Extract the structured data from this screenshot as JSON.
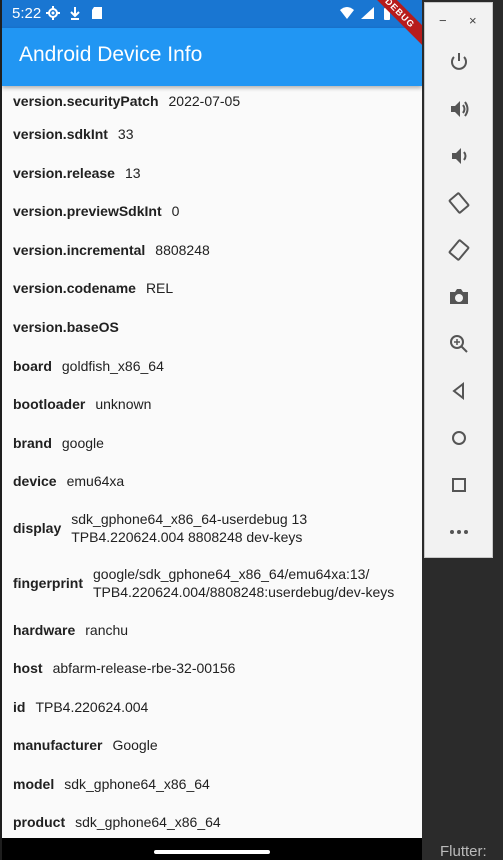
{
  "status_bar": {
    "time": "5:22"
  },
  "app_bar": {
    "title": "Android Device Info",
    "debug_banner": "DEBUG"
  },
  "rows": [
    {
      "key": "version.securityPatch",
      "value": "2022-07-05"
    },
    {
      "key": "version.sdkInt",
      "value": "33"
    },
    {
      "key": "version.release",
      "value": "13"
    },
    {
      "key": "version.previewSdkInt",
      "value": "0"
    },
    {
      "key": "version.incremental",
      "value": "8808248"
    },
    {
      "key": "version.codename",
      "value": "REL"
    },
    {
      "key": "version.baseOS",
      "value": ""
    },
    {
      "key": "board",
      "value": "goldfish_x86_64"
    },
    {
      "key": "bootloader",
      "value": "unknown"
    },
    {
      "key": "brand",
      "value": "google"
    },
    {
      "key": "device",
      "value": "emu64xa"
    },
    {
      "key": "display",
      "value": "sdk_gphone64_x86_64-userdebug 13 TPB4.220624.004 8808248 dev-keys"
    },
    {
      "key": "fingerprint",
      "value": "google/sdk_gphone64_x86_64/emu64xa:13/ TPB4.220624.004/8808248:userdebug/dev-keys"
    },
    {
      "key": "hardware",
      "value": "ranchu"
    },
    {
      "key": "host",
      "value": "abfarm-release-rbe-32-00156"
    },
    {
      "key": "id",
      "value": "TPB4.220624.004"
    },
    {
      "key": "manufacturer",
      "value": "Google"
    },
    {
      "key": "model",
      "value": "sdk_gphone64_x86_64"
    },
    {
      "key": "product",
      "value": "sdk_gphone64_x86_64"
    }
  ],
  "emulator_panel": {
    "minimize": "−",
    "close": "×",
    "tools": [
      "power-icon",
      "volume-up-icon",
      "volume-down-icon",
      "rotate-left-icon",
      "rotate-right-icon",
      "camera-icon",
      "zoom-icon",
      "back-icon",
      "home-icon",
      "overview-icon",
      "more-icon"
    ]
  },
  "background_text": "Flutter:"
}
